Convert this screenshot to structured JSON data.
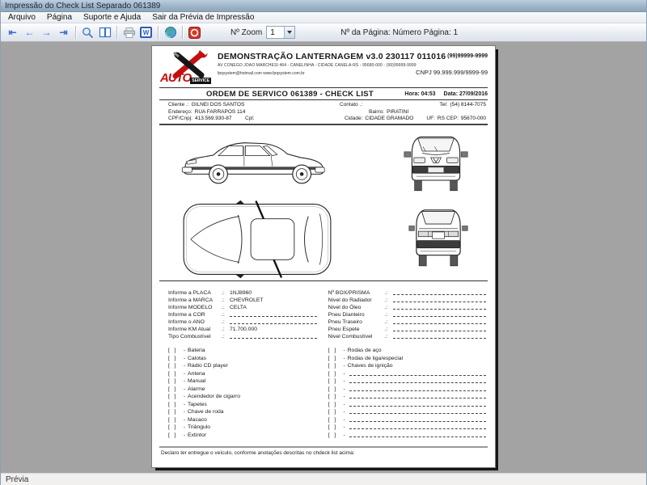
{
  "window": {
    "title": "Impressão do Check List Separado 061389"
  },
  "menu": {
    "items": [
      {
        "label": "Arquivo"
      },
      {
        "label": "Página"
      },
      {
        "label": "Suporte e Ajuda"
      },
      {
        "label": "Sair da Prévia de Impressão"
      }
    ]
  },
  "toolbar": {
    "icons": {
      "first": "⇤",
      "prev": "←",
      "next": "→",
      "last": "⇥",
      "word": "W"
    },
    "zoom_label": "Nº Zoom",
    "zoom_value": "1",
    "page_info": "Nº da Página: Número Página: 1"
  },
  "colors": {
    "logo_red": "#c40f0f",
    "arrow_blue": "#3b6fd4",
    "stop_red": "#d6382a",
    "workspace_gray": "#a3a3a3"
  },
  "doc": {
    "header": {
      "logo_auto": "AUTO",
      "logo_service": "SERVICE",
      "title": "DEMONSTRAÇÃO LANTERNAGEM v3.0 230117 011016",
      "phone": "(99)99999-9999",
      "address": "AV CONEGO JOAO MARCHESI 464 - CANELINHA - CIDADE CANELA-RS - 95680-000 - (99)99999-9999",
      "email_site": "fpqsystem@hotmail.com   www.fpqsystem.com.br",
      "cnpj": "CNPJ 99.999.999/9999-99"
    },
    "order": {
      "title": "ORDEM DE SERVICO 061389 - CHECK LIST",
      "time": "Hora: 04:53",
      "date": "Data: 27/09/2016"
    },
    "client": {
      "cliente_label": "Cliente .:",
      "cliente": "GILNEI DOS SANTOS",
      "contato_label": "Contato .:",
      "tel_label": "Tel:",
      "tel": "(54) 8144-7075",
      "endereco_label": "Endereço:",
      "endereco": "RUA FARRAPOS 114",
      "bairro_label": "Bairro:",
      "bairro": "PIRATINI",
      "cpf_label": "CPF/Cnpj:",
      "cpf": "413.569.930-87",
      "cpl_label": "Cpl:",
      "cidade_label": "Cidade:",
      "cidade": "CIDADE GRAMADO",
      "uf_label": "UF:",
      "uf": "RS",
      "cep_label": "CEP:",
      "cep": "95670-000"
    },
    "form": {
      "sep": ".:",
      "left": [
        {
          "label": "Informe a PLACA",
          "value": "1NJ8960",
          "blank": false
        },
        {
          "label": "Informe a MARCA",
          "value": "CHEVROLET",
          "blank": false
        },
        {
          "label": "Informe MODELO",
          "value": "CELTA",
          "blank": false
        },
        {
          "label": "Informe a COR",
          "value": "",
          "blank": true
        },
        {
          "label": "Informe o ANO",
          "value": "",
          "blank": true
        },
        {
          "label": "Informe KM Atual",
          "value": "71.700.000",
          "blank": false
        },
        {
          "label": "Tipo Combustível",
          "value": "",
          "blank": true
        }
      ],
      "right": [
        {
          "label": "Nº BOX/PRISMA",
          "value": "",
          "blank": true
        },
        {
          "label": "Nivel do Radiador",
          "value": "",
          "blank": true
        },
        {
          "label": "Nivel do Óleo",
          "value": "",
          "blank": true
        },
        {
          "label": "Pneu Dianteiro",
          "value": "",
          "blank": true
        },
        {
          "label": "Pneu Traseiro",
          "value": "",
          "blank": true
        },
        {
          "label": "Pneu Espete",
          "value": "",
          "blank": true
        },
        {
          "label": "Nivel Combustível",
          "value": "",
          "blank": true
        }
      ]
    },
    "checklist": {
      "box": "[   ]",
      "dash": "-",
      "left": [
        {
          "label": "Bateria",
          "blank": false
        },
        {
          "label": "Calotas",
          "blank": false
        },
        {
          "label": "Rádio CD player",
          "blank": false
        },
        {
          "label": "Antena",
          "blank": false
        },
        {
          "label": "Manual",
          "blank": false
        },
        {
          "label": "Alarme",
          "blank": false
        },
        {
          "label": "Acendedor de cigarro",
          "blank": false
        },
        {
          "label": "Tapetes",
          "blank": false
        },
        {
          "label": "Chave de roda",
          "blank": false
        },
        {
          "label": "Macaco",
          "blank": false
        },
        {
          "label": "Triângulo",
          "blank": false
        },
        {
          "label": "Extintor",
          "blank": false
        }
      ],
      "right": [
        {
          "label": "Rodas de aço",
          "blank": false
        },
        {
          "label": "Rodas de liga/especial",
          "blank": false
        },
        {
          "label": "Chaves de ignição",
          "blank": false
        },
        {
          "label": "",
          "blank": true
        },
        {
          "label": "",
          "blank": true
        },
        {
          "label": "",
          "blank": true
        },
        {
          "label": "",
          "blank": true
        },
        {
          "label": "",
          "blank": true
        },
        {
          "label": "",
          "blank": true
        },
        {
          "label": "",
          "blank": true
        },
        {
          "label": "",
          "blank": true
        },
        {
          "label": "",
          "blank": true
        }
      ]
    },
    "footer": {
      "declaration": "Declaro ter entregue o veículo, conforme anotações descritas no chdeck list acima:"
    }
  },
  "statusbar": {
    "text": "Prévia"
  }
}
